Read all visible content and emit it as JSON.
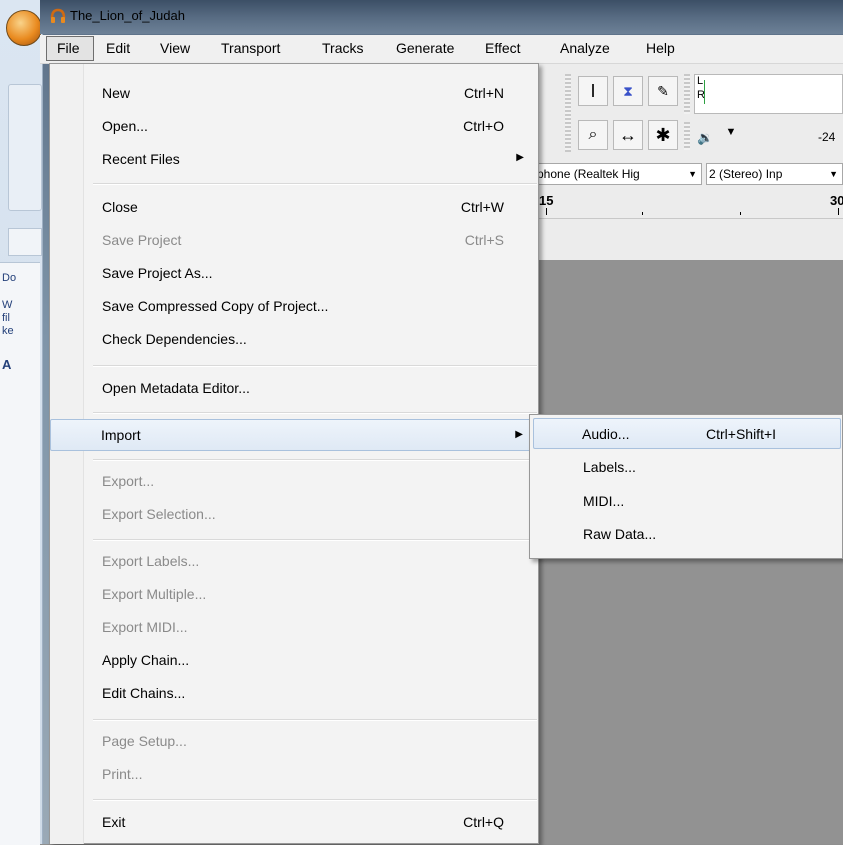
{
  "window": {
    "title": "The_Lion_of_Judah"
  },
  "left_pane": {
    "lines": [
      "Do",
      "W",
      "fil",
      "ke",
      "A"
    ]
  },
  "menubar": {
    "items": [
      {
        "label": "File"
      },
      {
        "label": "Edit"
      },
      {
        "label": "View"
      },
      {
        "label": "Transport"
      },
      {
        "label": "Tracks"
      },
      {
        "label": "Generate"
      },
      {
        "label": "Effect"
      },
      {
        "label": "Analyze"
      },
      {
        "label": "Help"
      }
    ]
  },
  "toolbar": {
    "meter_l": "L",
    "meter_r": "R",
    "vol_db": "-24",
    "input_device": "phone (Realtek Hig",
    "input_channels": "2 (Stereo) Inp"
  },
  "ruler": {
    "labels": [
      "15",
      "30"
    ]
  },
  "file_menu": {
    "new": {
      "label": "New",
      "shortcut": "Ctrl+N"
    },
    "open": {
      "label": "Open...",
      "shortcut": "Ctrl+O"
    },
    "recent": {
      "label": "Recent Files"
    },
    "close": {
      "label": "Close",
      "shortcut": "Ctrl+W"
    },
    "save_project": {
      "label": "Save Project",
      "shortcut": "Ctrl+S"
    },
    "save_as": {
      "label": "Save Project As..."
    },
    "save_compressed": {
      "label": "Save Compressed Copy of Project..."
    },
    "check_deps": {
      "label": "Check Dependencies..."
    },
    "metadata": {
      "label": "Open Metadata Editor..."
    },
    "import": {
      "label": "Import"
    },
    "export": {
      "label": "Export..."
    },
    "export_selection": {
      "label": "Export Selection..."
    },
    "export_labels": {
      "label": "Export Labels..."
    },
    "export_multiple": {
      "label": "Export Multiple..."
    },
    "export_midi": {
      "label": "Export MIDI..."
    },
    "apply_chain": {
      "label": "Apply Chain..."
    },
    "edit_chains": {
      "label": "Edit Chains..."
    },
    "page_setup": {
      "label": "Page Setup..."
    },
    "print": {
      "label": "Print..."
    },
    "exit": {
      "label": "Exit",
      "shortcut": "Ctrl+Q"
    }
  },
  "import_submenu": {
    "audio": {
      "label": "Audio...",
      "shortcut": "Ctrl+Shift+I"
    },
    "labels": {
      "label": "Labels..."
    },
    "midi": {
      "label": "MIDI..."
    },
    "raw": {
      "label": "Raw Data..."
    }
  }
}
